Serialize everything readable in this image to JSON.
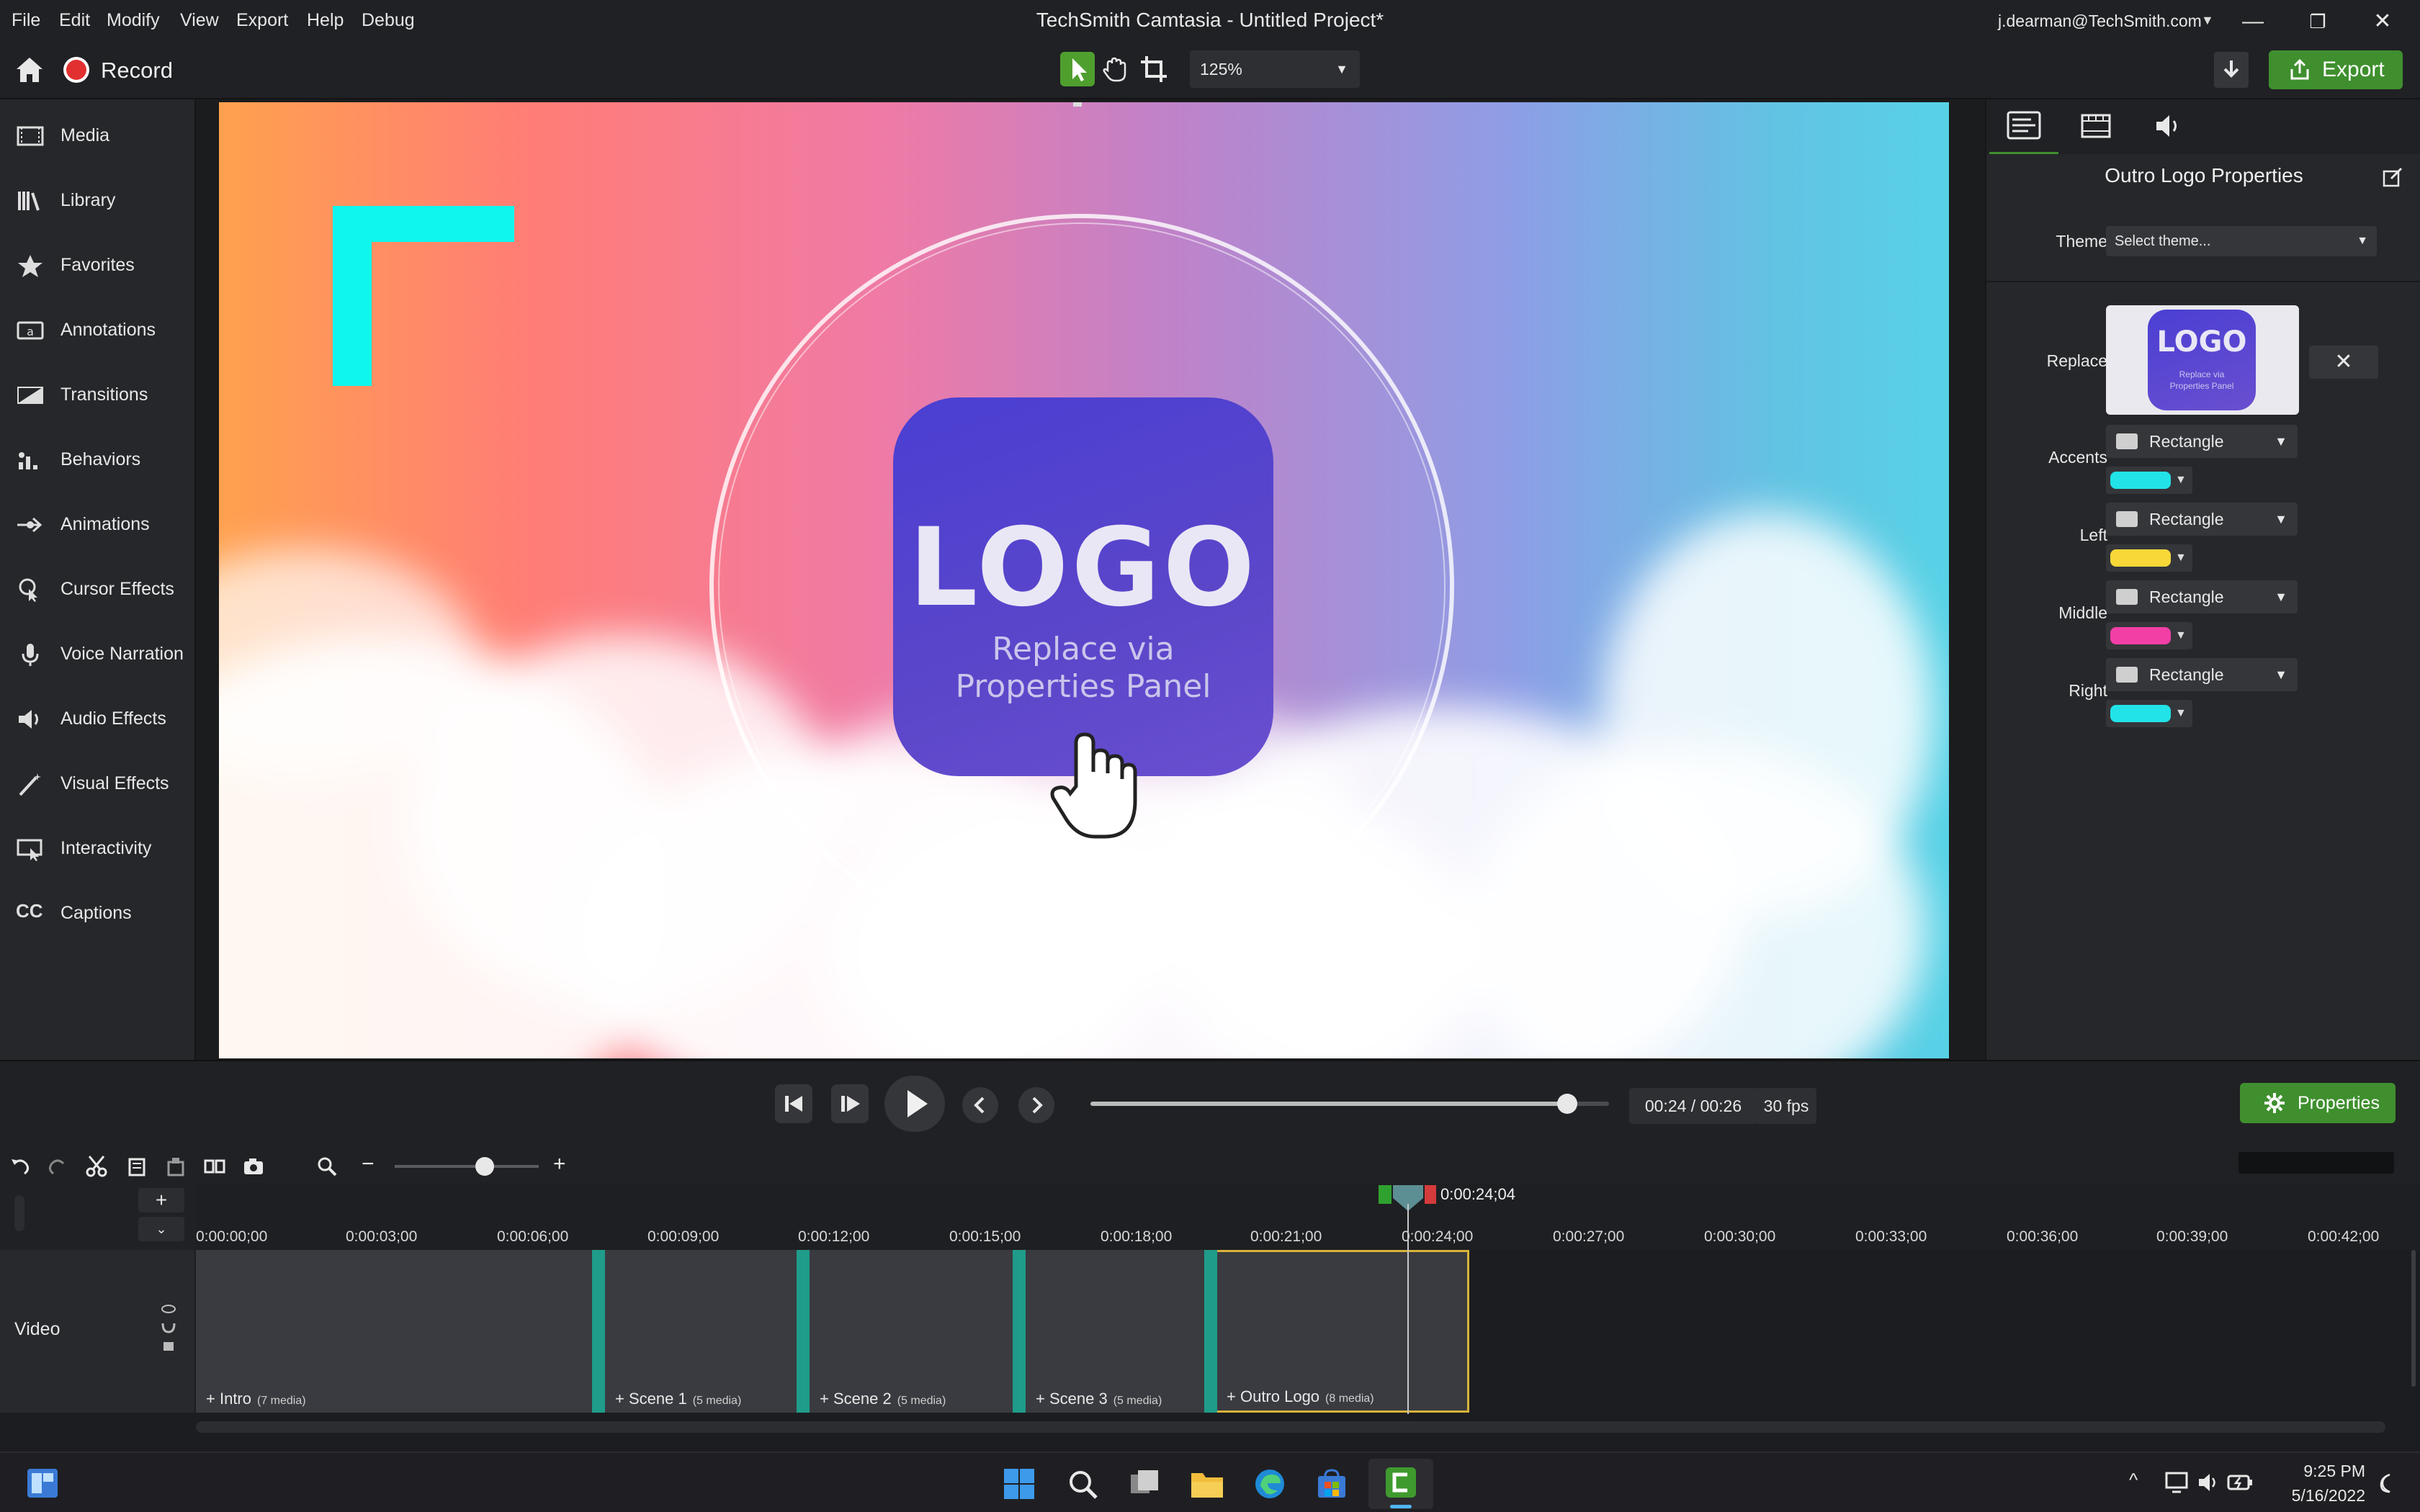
{
  "app": {
    "title": "TechSmith Camtasia - Untitled Project*",
    "account": "j.dearman@TechSmith.com"
  },
  "menu": {
    "items": [
      "File",
      "Edit",
      "Modify",
      "View",
      "Export",
      "Help",
      "Debug"
    ]
  },
  "toolbar": {
    "record_label": "Record",
    "zoom": "125%",
    "export_label": "Export"
  },
  "sidebar": {
    "items": [
      {
        "label": "Media",
        "icon": "film-icon"
      },
      {
        "label": "Library",
        "icon": "library-icon"
      },
      {
        "label": "Favorites",
        "icon": "star-icon"
      },
      {
        "label": "Annotations",
        "icon": "annotation-icon"
      },
      {
        "label": "Transitions",
        "icon": "transition-icon"
      },
      {
        "label": "Behaviors",
        "icon": "behavior-icon"
      },
      {
        "label": "Animations",
        "icon": "animation-icon"
      },
      {
        "label": "Cursor Effects",
        "icon": "cursor-icon"
      },
      {
        "label": "Voice Narration",
        "icon": "microphone-icon"
      },
      {
        "label": "Audio Effects",
        "icon": "speaker-icon"
      },
      {
        "label": "Visual Effects",
        "icon": "wand-icon"
      },
      {
        "label": "Interactivity",
        "icon": "interactivity-icon"
      },
      {
        "label": "Captions",
        "icon": "captions-icon"
      }
    ]
  },
  "canvas": {
    "logo_text": "LOGO",
    "logo_sub1": "Replace via",
    "logo_sub2": "Properties Panel"
  },
  "properties": {
    "title": "Outro Logo Properties",
    "theme_label": "Theme",
    "theme_value": "Select theme...",
    "replace_label": "Replace",
    "thumb_logo": "LOGO",
    "thumb_sub": "Replace via Properties Panel",
    "rows": [
      {
        "label": "Accents",
        "shape": "Rectangle",
        "color": "#22e3e8"
      },
      {
        "label": "Left",
        "shape": "Rectangle",
        "color": "#f7d838"
      },
      {
        "label": "Middle",
        "shape": "Rectangle",
        "color": "#f23fa6"
      },
      {
        "label": "Right",
        "shape": "Rectangle",
        "color": "#22e3e8"
      }
    ]
  },
  "playback": {
    "current": "00:24",
    "total": "00:26",
    "timecode": "00:24 / 00:26",
    "fps": "30 fps",
    "properties_label": "Properties",
    "progress": 0.92
  },
  "timeline": {
    "playhead": "0:00:24;04",
    "ticks": [
      "0:00:00;00",
      "0:00:03;00",
      "0:00:06;00",
      "0:00:09;00",
      "0:00:12;00",
      "0:00:15;00",
      "0:00:18;00",
      "0:00:21;00",
      "0:00:24;00",
      "0:00:27;00",
      "0:00:30;00",
      "0:00:33;00",
      "0:00:36;00",
      "0:00:39;00",
      "0:00:42;00"
    ],
    "track_label": "Video",
    "clips": [
      {
        "name": "Intro",
        "count": "(7 media)"
      },
      {
        "name": "Scene 1",
        "count": "(5 media)"
      },
      {
        "name": "Scene 2",
        "count": "(5 media)"
      },
      {
        "name": "Scene 3",
        "count": "(5 media)"
      },
      {
        "name": "Outro Logo",
        "count": "(8 media)"
      }
    ]
  },
  "taskbar": {
    "time": "9:25 PM",
    "date": "5/16/2022"
  },
  "colors": {
    "accent_green": "#3f8f2e",
    "teal": "#1f9c8a",
    "cyan": "#22e3e8"
  }
}
